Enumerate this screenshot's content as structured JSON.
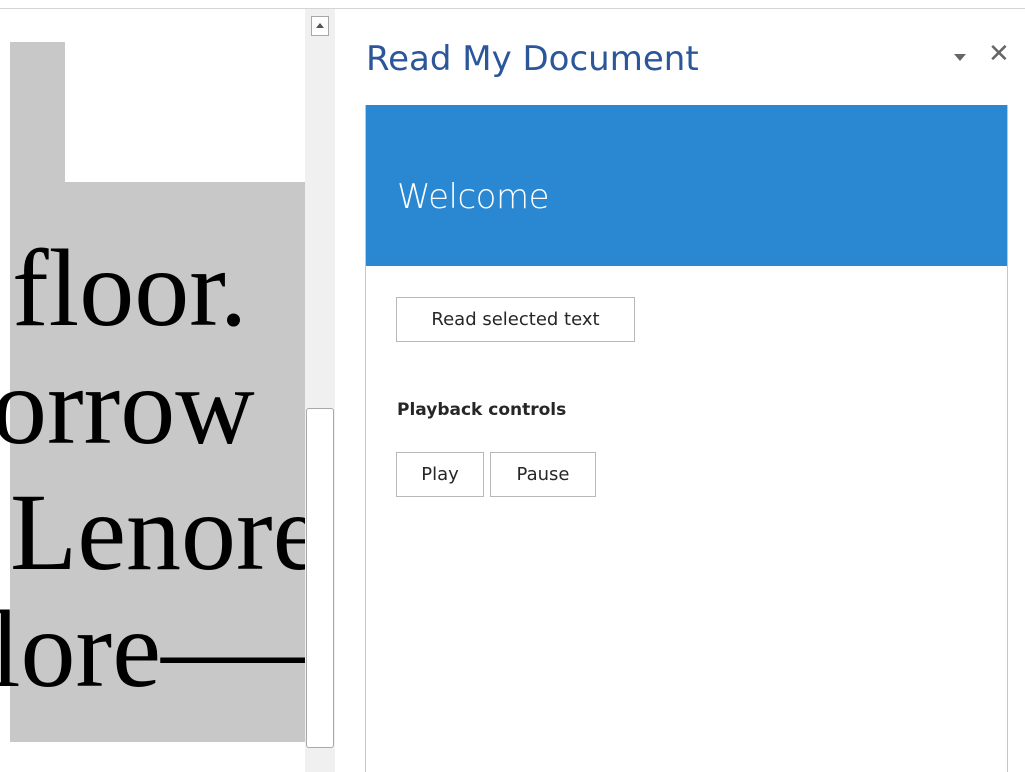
{
  "document": {
    "lines": [
      "floor.",
      "orrow",
      "Lenore",
      "lore——"
    ]
  },
  "pane": {
    "title": "Read My Document",
    "menu_icon": "chevron-down-icon",
    "close_symbol": "✕"
  },
  "addin": {
    "welcome": "Welcome",
    "read_button": "Read selected text",
    "playback_label": "Playback controls",
    "play_button": "Play",
    "pause_button": "Pause"
  },
  "colors": {
    "accent": "#2a88d2",
    "title": "#2b579a",
    "selection": "#c8c8c8"
  }
}
